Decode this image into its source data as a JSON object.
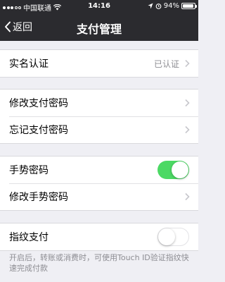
{
  "status_bar": {
    "carrier": "中国联通",
    "time": "14:16",
    "battery": "94%",
    "battery_level": 0.94
  },
  "nav": {
    "back_label": "返回",
    "title": "支付管理"
  },
  "groups": {
    "identity": {
      "realname_label": "实名认证",
      "realname_value": "已认证"
    },
    "password": {
      "modify_label": "修改支付密码",
      "forget_label": "忘记支付密码"
    },
    "gesture": {
      "gesture_label": "手势密码",
      "gesture_enabled": true,
      "modify_gesture_label": "修改手势密码"
    },
    "fingerprint": {
      "label": "指纹支付",
      "enabled": false,
      "hint": "开启后，转账或消费时，可使用Touch ID验证指纹快速完成付款"
    }
  },
  "colors": {
    "nav_background": "#2b2b2f",
    "toggle_on": "#4cd964",
    "page_background": "#efeff4"
  }
}
